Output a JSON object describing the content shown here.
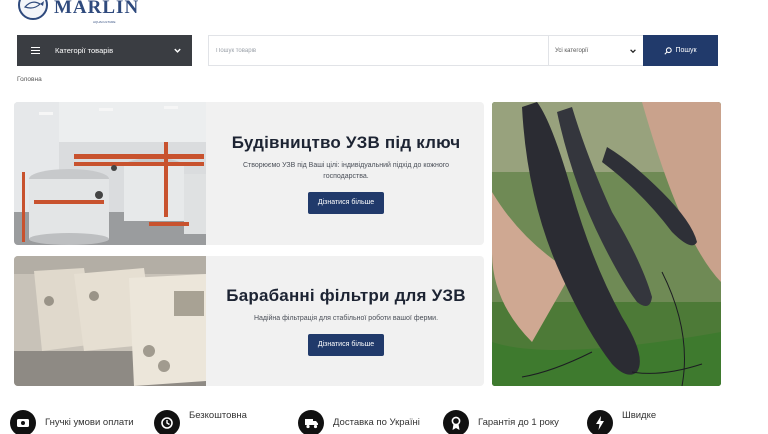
{
  "header": {
    "logo_text": "MARLIN",
    "logo_subtext": "AQUACULTURE"
  },
  "nav": {
    "categories_label": "Категорії товарів",
    "search_placeholder": "Пошук товарів",
    "category_select": "Усі категорії",
    "search_button": "Пошук"
  },
  "breadcrumb": "Головна",
  "banners": [
    {
      "title": "Будівництво УЗВ під ключ",
      "text": "Створюємо УЗВ під Ваші цілі: індивідуальний підхід до кожного господарства.",
      "button": "Дізнатися більше"
    },
    {
      "title": "Барабанні фільтри для УЗВ",
      "text": "Надійна фільтрація для стабільної роботи вашої ферми.",
      "button": "Дізнатися більше"
    }
  ],
  "benefits": [
    {
      "label": "Гнучкі умови оплати",
      "icon": "wallet-icon"
    },
    {
      "label": "Безкоштовна",
      "icon": "clock-icon"
    },
    {
      "label": "Доставка по Україні",
      "icon": "truck-icon"
    },
    {
      "label": "Гарантія до 1 року",
      "icon": "award-icon"
    },
    {
      "label": "Швидке",
      "icon": "lightning-icon"
    }
  ],
  "colors": {
    "accent": "#213a6b",
    "dark_bar": "#3a3d42",
    "banner_bg": "#f1f1f1"
  }
}
